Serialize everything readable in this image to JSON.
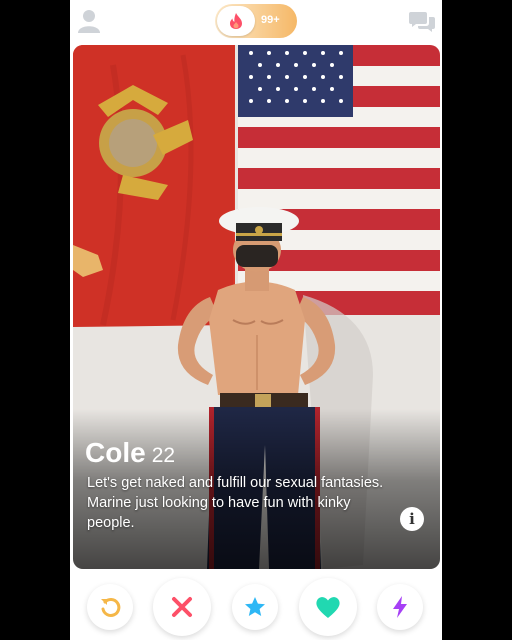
{
  "header": {
    "notification_count": "99+",
    "icons": [
      "profile-icon",
      "flame-icon",
      "chat-icon"
    ]
  },
  "profile": {
    "name": "Cole",
    "age": "22",
    "bio_lines": [
      "Let's get naked and fulfill our sexual fantasies.",
      "Marine just looking to have fun with kinky people."
    ]
  },
  "actions": [
    {
      "icon": "rewind-icon",
      "color": "#f5b748"
    },
    {
      "icon": "nope-icon",
      "color": "#fd5068"
    },
    {
      "icon": "super-like-icon",
      "color": "#2db7f5"
    },
    {
      "icon": "like-icon",
      "color": "#21d8b1"
    },
    {
      "icon": "boost-icon",
      "color": "#a640f5"
    }
  ],
  "colors": {
    "brand": "#fd5068",
    "toggle_gradient": [
      "#fde9c9",
      "#f5b867"
    ],
    "background": "#000000"
  }
}
